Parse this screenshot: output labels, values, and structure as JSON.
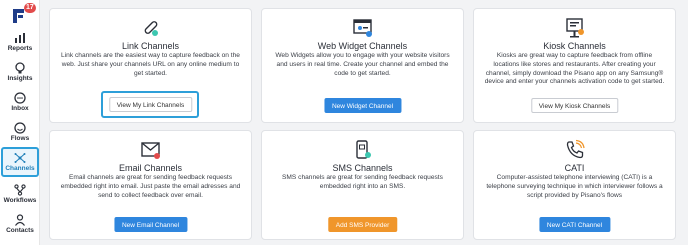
{
  "sidebar": {
    "badge": "17",
    "items": [
      {
        "label": "Reports",
        "icon": "bar-chart-icon"
      },
      {
        "label": "Insights",
        "icon": "lightbulb-icon"
      },
      {
        "label": "Inbox",
        "icon": "chat-bubble-icon"
      },
      {
        "label": "Flows",
        "icon": "smiley-icon"
      },
      {
        "label": "Channels",
        "icon": "network-icon",
        "active": true
      },
      {
        "label": "Workflows",
        "icon": "workflow-icon"
      },
      {
        "label": "Contacts",
        "icon": "person-icon"
      }
    ]
  },
  "cards": {
    "link": {
      "title": "Link Channels",
      "desc": "Link channels are the easiest way to capture feedback on the web. Just share your channels URL on any online medium to get started.",
      "button": "View My Link Channels"
    },
    "widget": {
      "title": "Web Widget Channels",
      "desc": "Web Widgets allow you to engage with your website visitors and users in real time. Create your channel and embed the code to get started.",
      "button": "New Widget Channel"
    },
    "kiosk": {
      "title": "Kiosk Channels",
      "desc": "Kiosks are great way to capture feedback from offline locations like stores and restaurants. After creating your channel, simply download the Pisano app on any Samsung® device and enter your channels activation code to get started.",
      "button": "View My Kiosk Channels"
    },
    "email": {
      "title": "Email Channels",
      "desc": "Email channels are great for sending feedback requests embedded right into email. Just paste the email adresses and send to collect feedback over email.",
      "button": "New Email Channel"
    },
    "sms": {
      "title": "SMS Channels",
      "desc": "SMS channels are great for sending feedback requests embedded right into an SMS.",
      "button": "Add SMS Provider"
    },
    "cati": {
      "title": "CATI",
      "desc": "Computer-assisted telephone interviewing (CATI) is a telephone surveying technique in which interviewer follows a script provided by Pisano's flows",
      "button": "New CATI Channel"
    }
  },
  "colors": {
    "accent_blue": "#2f86de",
    "highlight": "#2d9fd9",
    "orange": "#f0962b",
    "brand_red": "#e24b4b",
    "teal": "#3cc7b0"
  }
}
